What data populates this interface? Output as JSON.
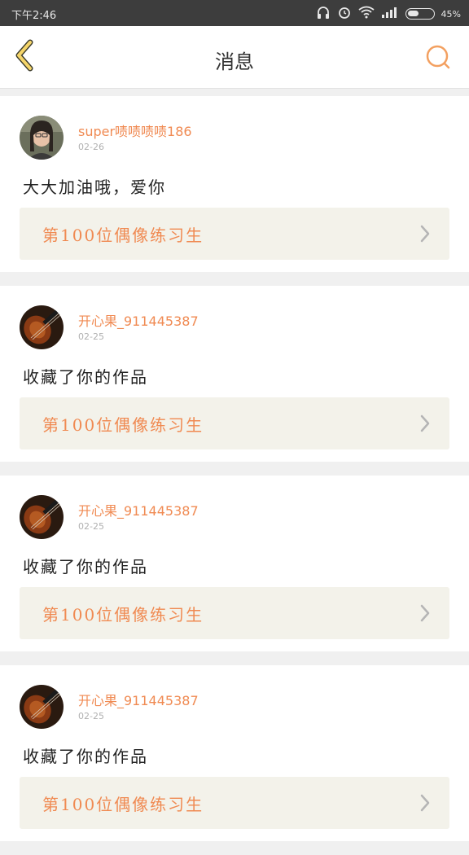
{
  "status": {
    "time": "下午2:46",
    "battery_text": "45%",
    "battery_level": 0.45
  },
  "header": {
    "title": "消息",
    "back_icon": "chevron-left-icon",
    "search_icon": "search-icon"
  },
  "messages": [
    {
      "username": "super啧啧啧啧186",
      "date": "02-26",
      "text": "大大加油哦，爱你",
      "work_title": "第100位偶像练习生",
      "avatar": "person-avatar"
    },
    {
      "username": "开心果_911445387",
      "date": "02-25",
      "text": "收藏了你的作品",
      "work_title": "第100位偶像练习生",
      "avatar": "violin-avatar"
    },
    {
      "username": "开心果_911445387",
      "date": "02-25",
      "text": "收藏了你的作品",
      "work_title": "第100位偶像练习生",
      "avatar": "violin-avatar"
    },
    {
      "username": "开心果_911445387",
      "date": "02-25",
      "text": "收藏了你的作品",
      "work_title": "第100位偶像练习生",
      "avatar": "violin-avatar"
    }
  ],
  "colors": {
    "accent": "#f08a52",
    "card_link_bg": "#f3f2ea",
    "status_bar": "#3d3d3d"
  }
}
